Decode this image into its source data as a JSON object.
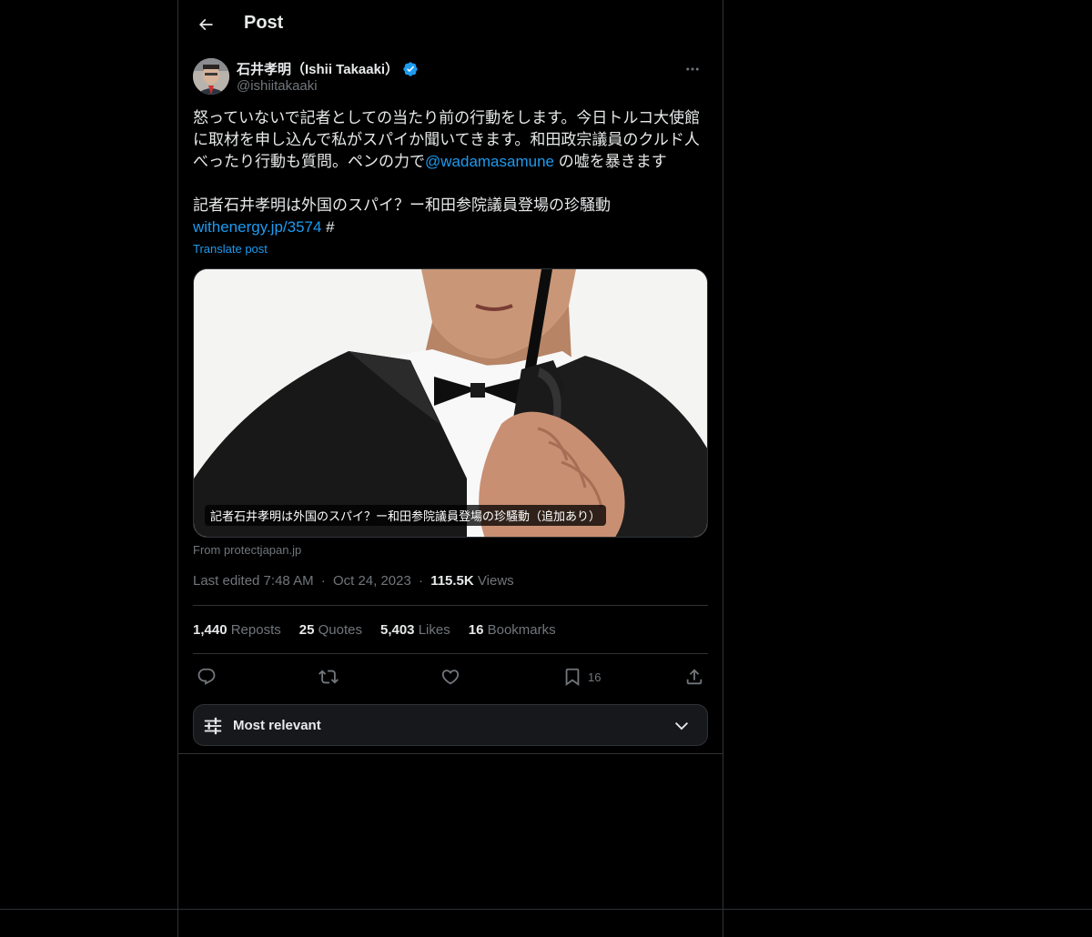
{
  "header": {
    "title": "Post"
  },
  "author": {
    "name": "石井孝明（Ishii Takaaki）",
    "handle": "@ishiitakaaki"
  },
  "post": {
    "line1": "怒っていないで記者としての当たり前の行動をします。今日トルコ大使館",
    "line2": "に取材を申し込んで私がスパイか聞いてきます。和田政宗議員のクルド人",
    "line3_prefix": "べったり行動も質問。ペンの力で",
    "mention": "@wadamasamune",
    "line3_suffix": " の嘘を暴きます",
    "line4": "記者石井孝明は外国のスパイ？ー和田参院議員登場の珍騒動",
    "link": "withenergy.jp/3574",
    "link_suffix": " #",
    "translate_label": "Translate post"
  },
  "card": {
    "caption": "記者石井孝明は外国のスパイ？ー和田参院議員登場の珍騒動（追加あり）",
    "source": "From protectjapan.jp"
  },
  "meta": {
    "edited": "Last edited 7:48 AM",
    "separator": "·",
    "date": "Oct 24, 2023",
    "views_count": "115.5K",
    "views_label": "Views"
  },
  "stats": {
    "reposts_count": "1,440",
    "reposts_label": "Reposts",
    "quotes_count": "25",
    "quotes_label": "Quotes",
    "likes_count": "5,403",
    "likes_label": "Likes",
    "bookmarks_count": "16",
    "bookmarks_label": "Bookmarks"
  },
  "actions": {
    "bookmark_count": "16",
    "icons": [
      "reply-icon",
      "repost-icon",
      "like-icon",
      "bookmark-icon",
      "share-icon"
    ]
  },
  "sort": {
    "label": "Most relevant"
  },
  "colors": {
    "background": "#000000",
    "text": "#e7e9ea",
    "muted": "#71767b",
    "accent": "#1d9bf0",
    "border": "#2f3336"
  }
}
